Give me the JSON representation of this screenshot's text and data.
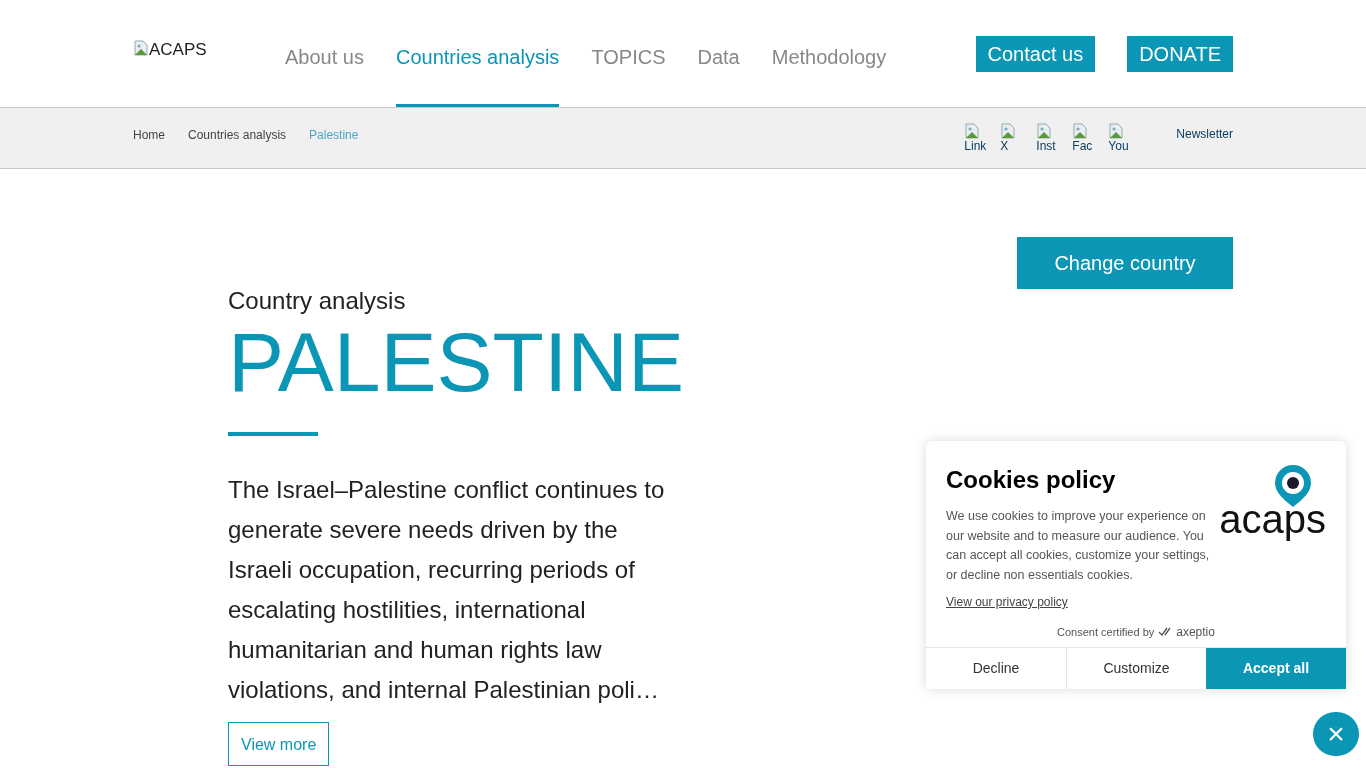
{
  "header": {
    "logo_alt": "ACAPS",
    "nav": [
      {
        "label": "About us",
        "selected": false
      },
      {
        "label": "Countries analysis",
        "selected": true
      },
      {
        "label": "TOPICS",
        "selected": false
      },
      {
        "label": "Data",
        "selected": false
      },
      {
        "label": "Methodology",
        "selected": false
      }
    ],
    "buttons": [
      "Contact us",
      "DONATE"
    ]
  },
  "breadcrumb": [
    {
      "label": "Home",
      "current": false
    },
    {
      "label": "Countries analysis",
      "current": false
    },
    {
      "label": "Palestine",
      "current": true
    }
  ],
  "social_links": [
    "Link",
    "X",
    "Inst",
    "Fac",
    "You"
  ],
  "newsletter": "Newsletter",
  "change_country": "Change country",
  "eyebrow": "Country analysis",
  "title": "PALESTINE",
  "description": "The Israel–Palestine conflict continues to generate severe needs driven by the Israeli occupation, recurring periods of escalating hostilities, international humanitarian and human rights law violations, and internal Palestinian poli…",
  "view_more": "View more",
  "cookie_dialog": {
    "title": "Cookies policy",
    "logo_text": "acaps",
    "body": "We use cookies to improve your experience on our website and to measure our audience. You can accept all cookies, customize your settings, or decline non essentials cookies.",
    "privacy_link": "View our privacy policy",
    "certified": "Consent certified by",
    "certifier": "axeptio",
    "buttons": [
      {
        "label": "Decline",
        "primary": false
      },
      {
        "label": "Customize",
        "primary": false
      },
      {
        "label": "Accept all",
        "primary": true
      }
    ]
  },
  "close_button": "×"
}
